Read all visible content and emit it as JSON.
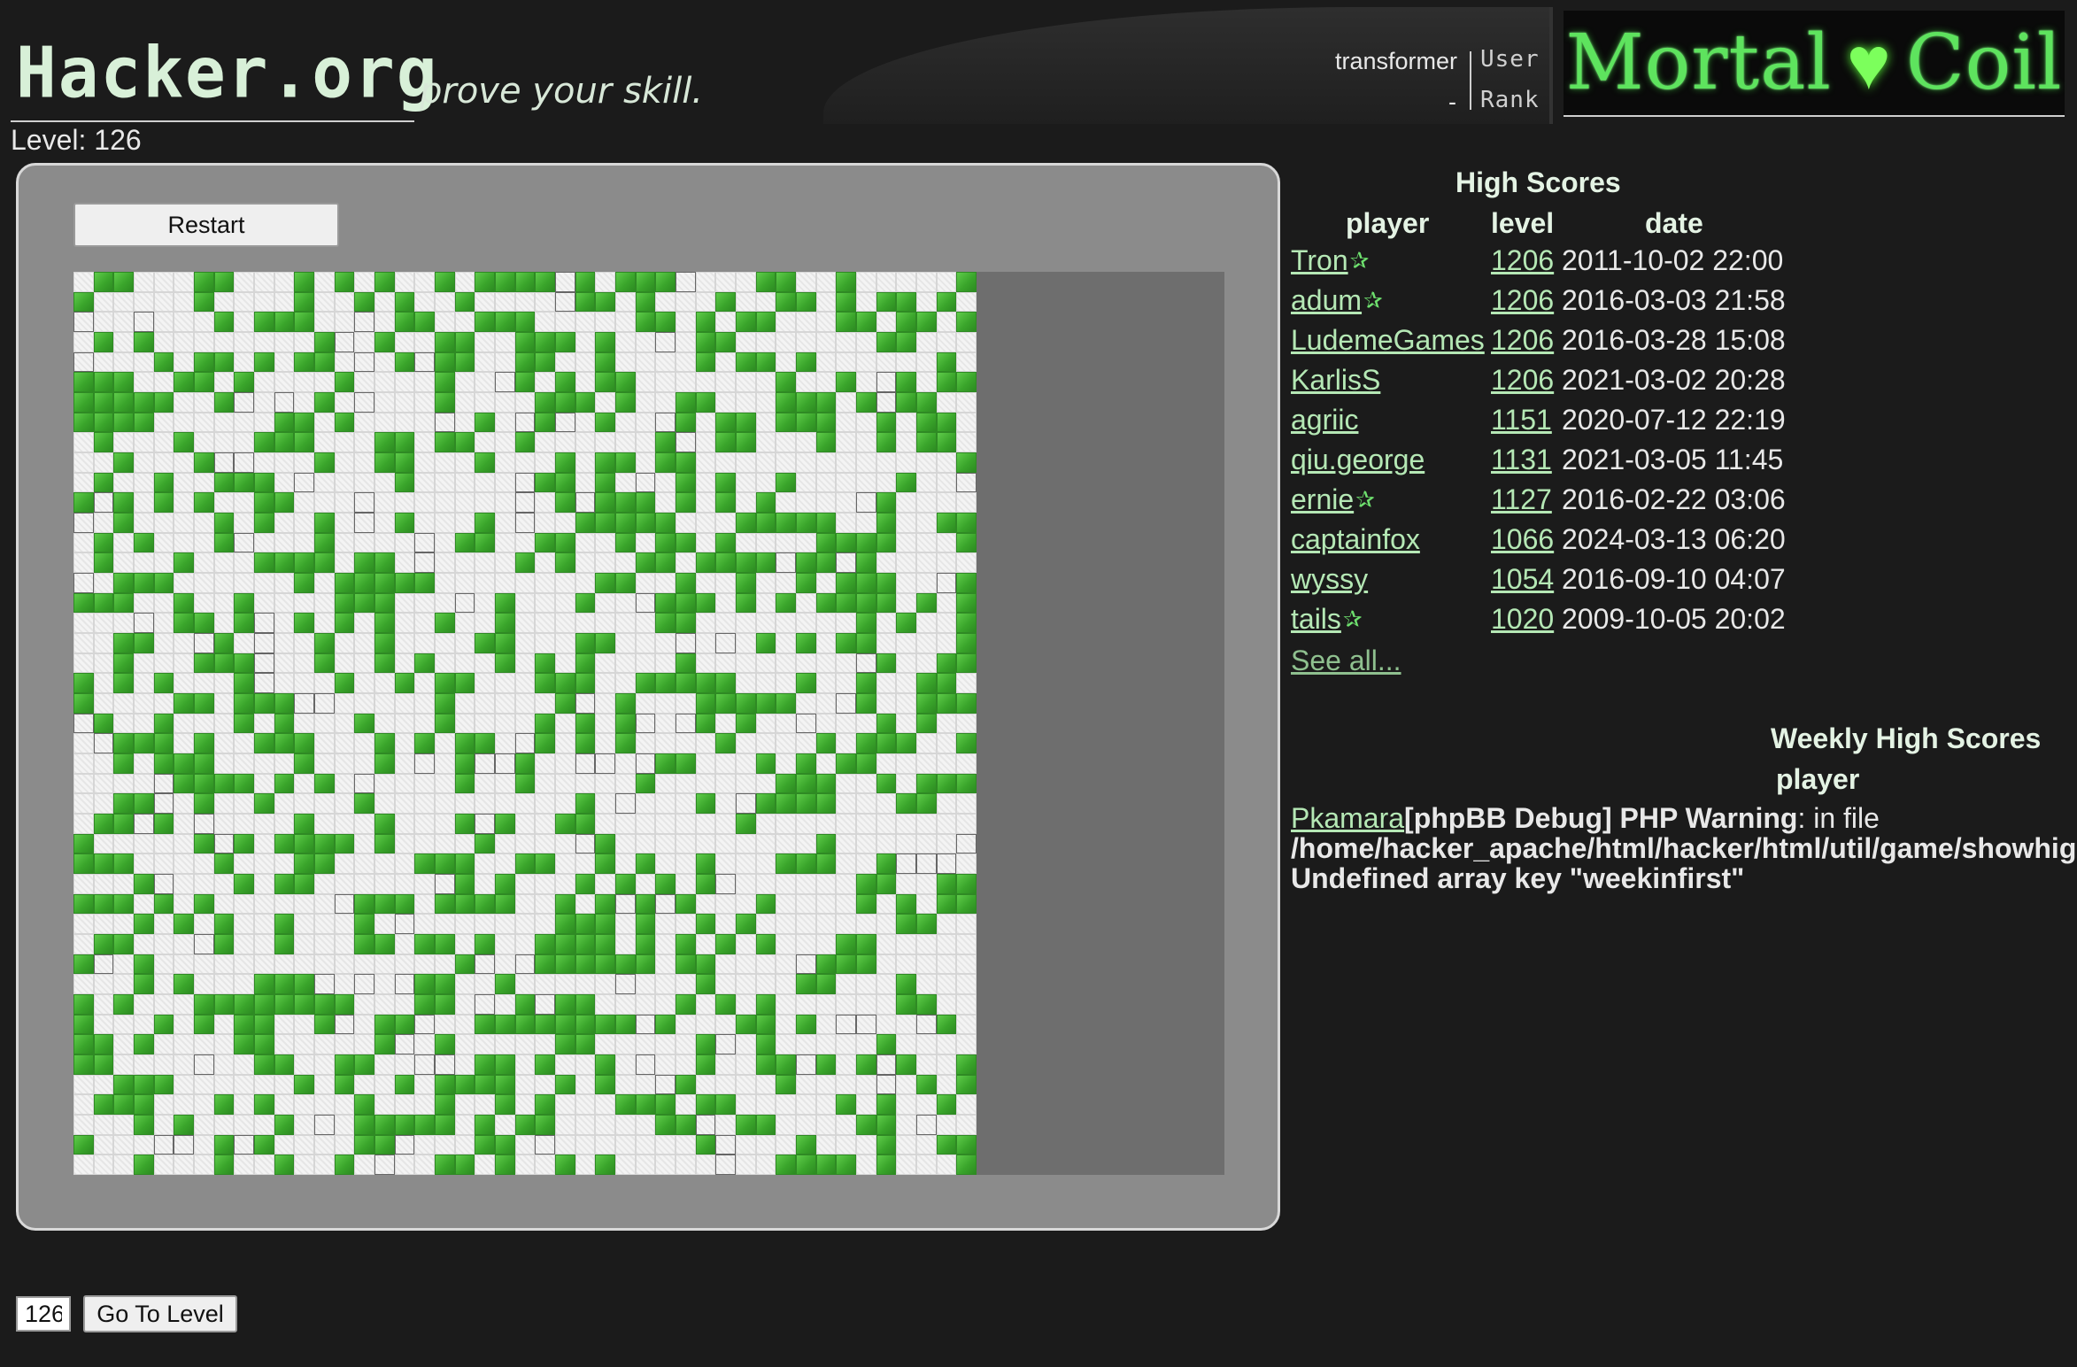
{
  "header": {
    "site_logo": "Hacker.org",
    "tagline": "prove your skill.",
    "username": "transformer",
    "rank_value": "-",
    "user_label": "User",
    "rank_label": "Rank",
    "game_logo_left": "Mortal",
    "game_logo_right": "Coil"
  },
  "level_label": "Level: 126",
  "game": {
    "restart_label": "Restart",
    "grid_columns": 45,
    "grid_rows": 45
  },
  "controls": {
    "level_input_value": "126",
    "go_button_label": "Go To Level"
  },
  "high_scores": {
    "title": "High Scores",
    "columns": [
      "player",
      "level",
      "date"
    ],
    "rows": [
      {
        "player": "Tron",
        "star": true,
        "level": "1206",
        "date": "2011-10-02 22:00"
      },
      {
        "player": "adum",
        "star": true,
        "level": "1206",
        "date": "2016-03-03 21:58"
      },
      {
        "player": "LudemeGames",
        "star": false,
        "level": "1206",
        "date": "2016-03-28 15:08"
      },
      {
        "player": "KarlisS",
        "star": false,
        "level": "1206",
        "date": "2021-03-02 20:28"
      },
      {
        "player": "agriic",
        "star": false,
        "level": "1151",
        "date": "2020-07-12 22:19"
      },
      {
        "player": "qiu.george",
        "star": false,
        "level": "1131",
        "date": "2021-03-05 11:45"
      },
      {
        "player": "ernie",
        "star": true,
        "level": "1127",
        "date": "2016-02-22 03:06"
      },
      {
        "player": "captainfox",
        "star": false,
        "level": "1066",
        "date": "2024-03-13 06:20"
      },
      {
        "player": "wyssy",
        "star": false,
        "level": "1054",
        "date": "2016-09-10 04:07"
      },
      {
        "player": "tails",
        "star": true,
        "level": "1020",
        "date": "2009-10-05 20:02"
      }
    ],
    "see_all": "See all..."
  },
  "weekly": {
    "title": "Weekly High Scores",
    "player_header": "player",
    "player": "Pkamara",
    "debug_bold": "[phpBB Debug] PHP Warning",
    "debug_rest": ": in file",
    "debug_path": "/home/hacker_apache/html/hacker/html/util/game/showhig",
    "debug_message": "Undefined array key \"weekinfirst\""
  },
  "colors": {
    "wall": "#3aa52b",
    "open_cell": "#f4f4f4",
    "panel": "#8b8b8b",
    "page_bg": "#1b1b1b",
    "link": "#b5e8b5"
  }
}
